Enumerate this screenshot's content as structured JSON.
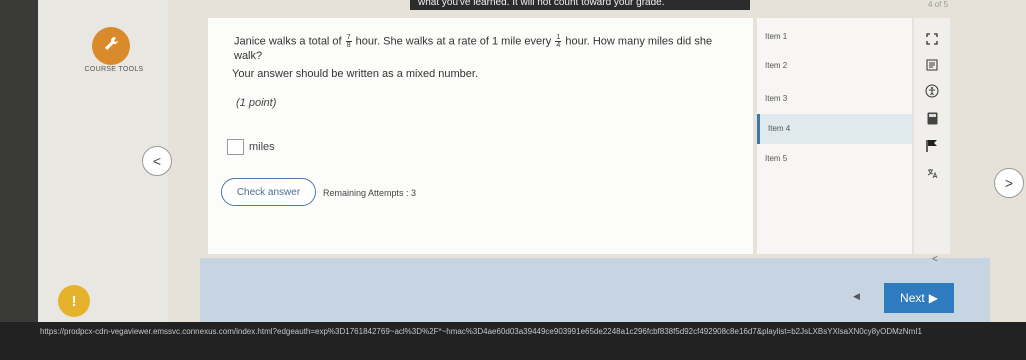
{
  "header": {
    "banner_text": "what you've learned. It will not count toward your grade.",
    "page_count": "4 of 5"
  },
  "left": {
    "course_tools_label": "COURSE TOOLS",
    "prev_symbol": "<",
    "alert_symbol": "!"
  },
  "question": {
    "text_before_frac1": "Janice walks a total of",
    "frac1_num": "7",
    "frac1_den": "8",
    "text_between": "hour. She walks at a rate of 1 mile every",
    "frac2_num": "1",
    "frac2_den": "4",
    "text_after": "hour. How many miles did she walk?",
    "instruction": "Your answer should be written as a mixed number.",
    "points": "(1 point)",
    "answer_unit": "miles",
    "answer_value": "",
    "check_label": "Check answer",
    "attempts_text": "Remaining Attempts : 3"
  },
  "items": [
    {
      "label": "Item 1"
    },
    {
      "label": "Item 2"
    },
    {
      "label": "Item 3"
    },
    {
      "label": "Item 4"
    },
    {
      "label": "Item 5"
    }
  ],
  "active_item": "Item 4",
  "side_icons": [
    "expand-icon",
    "notes-icon",
    "accessibility-icon",
    "calculator-icon",
    "flag-icon",
    "translate-icon"
  ],
  "navigation": {
    "next_label": "Next",
    "next_symbol": "▶",
    "back_symbol": "◀",
    "collapse_symbol": "<",
    "right_symbol": ">"
  },
  "url": "https://prodpcx-cdn-vegaviewer.emssvc.connexus.com/index.html?edgeauth=exp%3D1761842769~acl%3D%2F*~hmac%3D4ae60d03a39449ce903991e65de2248a1c296fcbf838f5d92cf492908c8e16d7&playlist=b2JsLXBsYXlsaXN0cy8yODMzNmI1",
  "colors": {
    "accent_blue": "#2f7bbf",
    "tool_orange": "#d98a2b",
    "alert_yellow": "#e6b22b",
    "band_blue": "#c7d4e1"
  }
}
